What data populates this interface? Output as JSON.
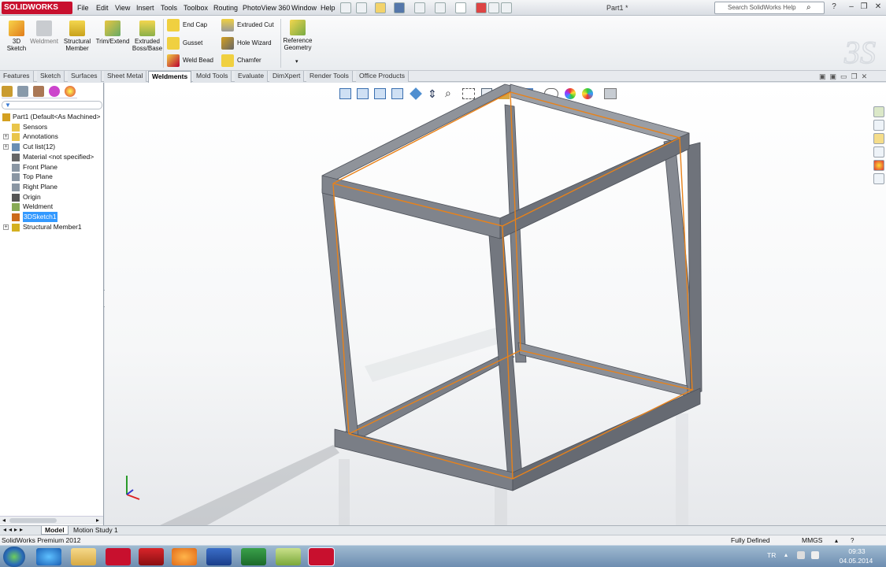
{
  "app": {
    "brand": "SOLIDWORKS",
    "document_title": "Part1 *",
    "search_placeholder": "Search SolidWorks Help"
  },
  "menu": [
    "File",
    "Edit",
    "View",
    "Insert",
    "Tools",
    "Toolbox",
    "Routing",
    "PhotoView 360",
    "Window",
    "Help"
  ],
  "ribbon": {
    "sketch3d": "3D\nSketch",
    "weldment": "Weldment",
    "structural_member": "Structural\nMember",
    "trim_extend": "Trim/Extend",
    "extruded_boss": "Extruded\nBoss/Base",
    "end_cap": "End Cap",
    "gusset": "Gusset",
    "weld_bead": "Weld Bead",
    "extruded_cut": "Extruded Cut",
    "hole_wizard": "Hole Wizard",
    "chamfer": "Chamfer",
    "reference_geometry": "Reference\nGeometry"
  },
  "tabs": [
    "Features",
    "Sketch",
    "Surfaces",
    "Sheet Metal",
    "Weldments",
    "Mold Tools",
    "Evaluate",
    "DimXpert",
    "Render Tools",
    "Office Products"
  ],
  "active_tab": "Weldments",
  "tree": [
    {
      "label": "Part1  (Default<As Machined>",
      "icon": "part-icon",
      "expand": ""
    },
    {
      "label": "Sensors",
      "icon": "sensors-icon",
      "expand": ""
    },
    {
      "label": "Annotations",
      "icon": "annotations-icon",
      "expand": "+"
    },
    {
      "label": "Cut list(12)",
      "icon": "cut-list-icon",
      "expand": "+"
    },
    {
      "label": "Material <not specified>",
      "icon": "material-icon",
      "expand": ""
    },
    {
      "label": "Front Plane",
      "icon": "plane-icon",
      "expand": ""
    },
    {
      "label": "Top Plane",
      "icon": "plane-icon",
      "expand": ""
    },
    {
      "label": "Right Plane",
      "icon": "plane-icon",
      "expand": ""
    },
    {
      "label": "Origin",
      "icon": "origin-icon",
      "expand": ""
    },
    {
      "label": "Weldment",
      "icon": "weldment-icon",
      "expand": ""
    },
    {
      "label": "3DSketch1",
      "icon": "sketch-icon",
      "expand": ""
    },
    {
      "label": "Structural Member1",
      "icon": "structural-member-icon",
      "expand": "+"
    }
  ],
  "bottom_tabs": [
    "Model",
    "Motion Study 1"
  ],
  "status": {
    "product": "SolidWorks Premium 2012",
    "state": "Fully Defined",
    "units": "MMGS"
  },
  "taskbar": {
    "lang": "TR",
    "time": "09:33",
    "date": "04.05.2014"
  },
  "colors": {
    "frame": "#7d8189",
    "sketch_line": "#e8821a",
    "selection": "#3399ff",
    "brand": "#c8102e"
  }
}
